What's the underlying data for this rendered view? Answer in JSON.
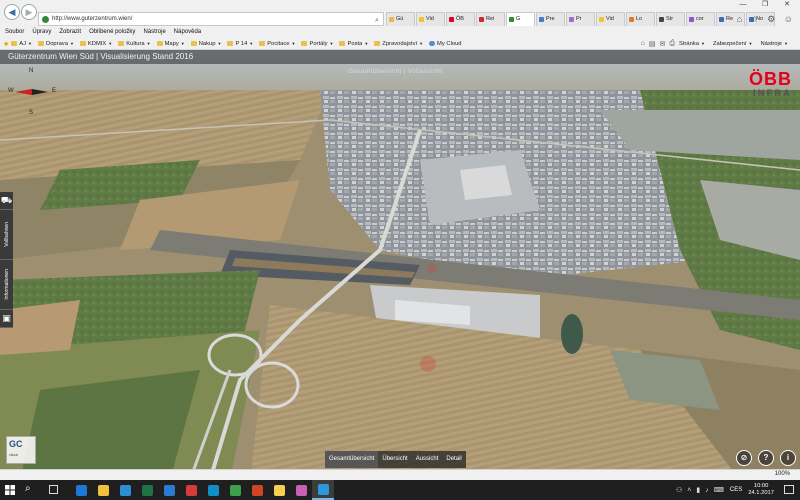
{
  "browser": {
    "url": "http://www.guterzentrum.wien/",
    "tabs": [
      {
        "label": "Gü",
        "color": "#e8b84e"
      },
      {
        "label": "Vid",
        "color": "#f1c232"
      },
      {
        "label": "ÖB",
        "color": "#e2001a"
      },
      {
        "label": "Rei",
        "color": "#cc2b2b"
      },
      {
        "label": "G",
        "color": "#2f8a3a",
        "active": true
      },
      {
        "label": "Pre",
        "color": "#4a78c2"
      },
      {
        "label": "Pr",
        "color": "#9c6ad1"
      },
      {
        "label": "Vid",
        "color": "#f1c232"
      },
      {
        "label": "Lo",
        "color": "#e07b28"
      },
      {
        "label": "Str",
        "color": "#444444"
      },
      {
        "label": "cor",
        "color": "#8f55c9"
      },
      {
        "label": "Re",
        "color": "#3b6cb5"
      },
      {
        "label": "No",
        "color": "#3b6cb5"
      }
    ],
    "window_buttons": [
      "—",
      "❐",
      "✕"
    ],
    "menu": [
      "Soubor",
      "Úpravy",
      "Zobrazit",
      "Oblíbené položky",
      "Nástroje",
      "Nápověda"
    ],
    "favorites": [
      {
        "label": "AJ",
        "dropdown": true
      },
      {
        "label": "Doprava",
        "dropdown": true
      },
      {
        "label": "KDMIX",
        "dropdown": true
      },
      {
        "label": "Kultura",
        "dropdown": true
      },
      {
        "label": "Mapy",
        "dropdown": true
      },
      {
        "label": "Nakup",
        "dropdown": true
      },
      {
        "label": "P 14",
        "dropdown": true
      },
      {
        "label": "Pocitace",
        "dropdown": true
      },
      {
        "label": "Portály",
        "dropdown": true
      },
      {
        "label": "Posta",
        "dropdown": true
      },
      {
        "label": "Zpravodajství",
        "dropdown": true
      },
      {
        "label": "My Cloud",
        "dropdown": false
      }
    ],
    "commands": [
      {
        "label": "Stránka"
      },
      {
        "label": "Zabezpečení"
      },
      {
        "label": "Nástroje"
      }
    ],
    "zoom": "100%"
  },
  "page": {
    "title": "Güterzentrum Wien Süd | Visualisierung Stand 2016",
    "scene_label": "Gesamtübersicht | Vollansicht",
    "compass": {
      "n": "N",
      "s": "S",
      "w": "W",
      "e": "E"
    },
    "logo": {
      "mark": "ÖBB",
      "sub": "INFRA",
      "color": "#e2001a"
    },
    "side_panel": [
      {
        "type": "icon",
        "label": "⛟"
      },
      {
        "type": "text",
        "label": "Vollbahnen"
      },
      {
        "type": "text",
        "label": "Informationen"
      },
      {
        "type": "icon",
        "label": "▣"
      }
    ],
    "view_tabs": [
      {
        "label": "Gesamtübersicht",
        "active": true
      },
      {
        "label": "Übersicht",
        "active": false
      },
      {
        "label": "Aussicht",
        "active": false
      },
      {
        "label": "Detail",
        "active": false
      }
    ],
    "controls": [
      "⊘",
      "?",
      "i"
    ],
    "company_logo": {
      "mark": "GC",
      "text": "visual"
    }
  },
  "taskbar": {
    "apps": [
      {
        "name": "edge",
        "color": "#1e78d6"
      },
      {
        "name": "explorer",
        "color": "#f0c23c"
      },
      {
        "name": "store",
        "color": "#2c8fd6"
      },
      {
        "name": "excel",
        "color": "#1f7244"
      },
      {
        "name": "mail",
        "color": "#2b7bd3"
      },
      {
        "name": "media",
        "color": "#d63b3b"
      },
      {
        "name": "maps",
        "color": "#0f8ec9"
      },
      {
        "name": "spreadsheet",
        "color": "#3aa04a"
      },
      {
        "name": "ppt",
        "color": "#d14424"
      },
      {
        "name": "notes",
        "color": "#f7d04f"
      },
      {
        "name": "photo",
        "color": "#c75fb3"
      },
      {
        "name": "ie",
        "color": "#2a9ad9",
        "active": true
      }
    ],
    "lang": "CES",
    "time": "10:00",
    "date": "24.1.2017"
  }
}
